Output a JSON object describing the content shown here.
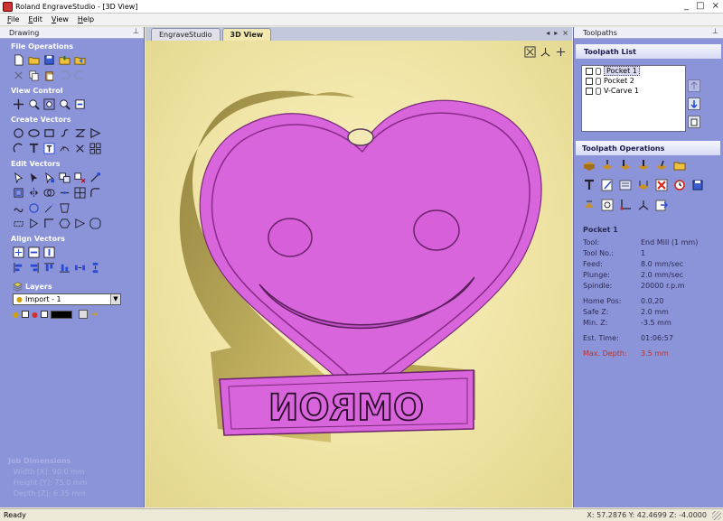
{
  "window": {
    "title": "Roland EngraveStudio - [3D View]",
    "controls": [
      "_",
      "□",
      "×"
    ]
  },
  "menu": [
    "File",
    "Edit",
    "View",
    "Help"
  ],
  "drawing_panel": {
    "title": "Drawing",
    "sections": {
      "file_operations": "File Operations",
      "view_control": "View Control",
      "create_vectors": "Create Vectors",
      "edit_vectors": "Edit Vectors",
      "align_vectors": "Align Vectors"
    },
    "layers": {
      "title": "Layers",
      "current": "Import - 1"
    },
    "job_dimensions": {
      "title": "Job Dimensions",
      "width_label": "Width  [X]:",
      "width_value": "90.0 mm",
      "height_label": "Height [Y]:",
      "height_value": "75.0 mm",
      "depth_label": "Depth  [Z]:",
      "depth_value": "6.35 mm"
    }
  },
  "view": {
    "tabs": [
      "EngraveStudio",
      "3D View"
    ],
    "active_tab": "3D View",
    "model_text": "OMRON",
    "colors": {
      "model": "#d965dc",
      "background": "#f3e9b0",
      "base": "#bdaa55"
    }
  },
  "toolpaths_panel": {
    "title": "Toolpaths",
    "list_title": "Toolpath List",
    "items": [
      {
        "name": "Pocket 1",
        "selected": true
      },
      {
        "name": "Pocket 2",
        "selected": false
      },
      {
        "name": "V-Carve 1",
        "selected": false
      }
    ],
    "operations_title": "Toolpath Operations",
    "summary": {
      "name": "Pocket 1",
      "tool_label": "Tool:",
      "tool_value": "End Mill (1 mm)",
      "tool_no_label": "Tool No.:",
      "tool_no_value": "1",
      "feed_label": "Feed:",
      "feed_value": "8.0 mm/sec",
      "plunge_label": "Plunge:",
      "plunge_value": "2.0 mm/sec",
      "spindle_label": "Spindle:",
      "spindle_value": "20000 r.p.m",
      "home_label": "Home Pos:",
      "home_value": "0.0,20",
      "safez_label": "Safe Z:",
      "safez_value": "2.0 mm",
      "minz_label": "Min. Z:",
      "minz_value": "-3.5 mm",
      "est_label": "Est. Time:",
      "est_value": "01:06:57",
      "maxd_label": "Max. Depth:",
      "maxd_value": "3.5 mm"
    }
  },
  "status": {
    "text": "Ready",
    "coords": "X: 57.2876 Y: 42.4699 Z: -4.0000"
  }
}
